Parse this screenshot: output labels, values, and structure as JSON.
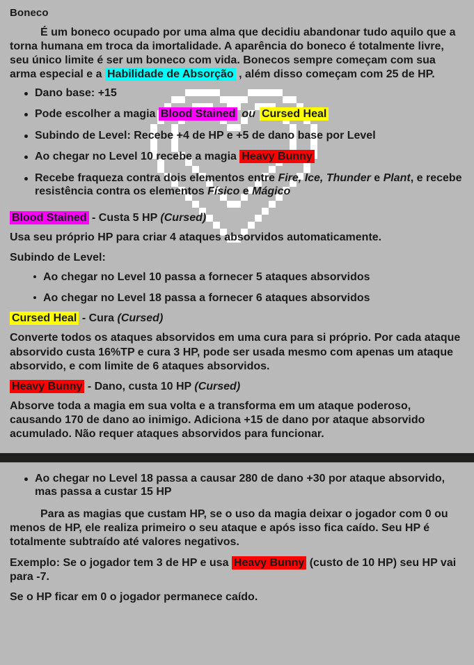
{
  "document": {
    "title": "Boneco",
    "background_color": "#b9b9b9",
    "band_color": "#1f1f1d",
    "watermark": "pixel-heart-outline"
  },
  "colors": {
    "cyan": "#00ffff",
    "magenta": "#ff00ff",
    "yellow": "#ffff00",
    "red": "#ff0000",
    "text": "#1a1a1a"
  },
  "intro": {
    "part1": "É um boneco ocupado por uma alma que decidiu abandonar tudo aquilo que a torna humana em troca da imortalidade. A aparência do boneco é totalmente livre, seu único limite é ser um boneco com vida. Bonecos sempre começam com sua arma especial e a ",
    "highlight": "Habilidade de Absorção",
    "part2": " , além disso começam com 25 de HP."
  },
  "class_bullets": {
    "b1": "Dano base: +15",
    "b2_pre": "Pode escolher a magia ",
    "b2_spell_a": "Blood Stained",
    "b2_conj": "ou",
    "b2_spell_b": "Cursed Heal",
    "b3": "Subindo de Level: Recebe +4 de HP e +5 de dano base por Level",
    "b4_pre": "Ao chegar no Level 10 recebe a magia ",
    "b4_spell": "Heavy Bunny",
    "b5_pre": "Recebe fraqueza contra dois elementos entre ",
    "b5_el1": "Fire, Ice, Thunder",
    "b5_mid": " e ",
    "b5_el2": "Plant",
    "b5_mid2": ", e recebe resistência contra os elementos ",
    "b5_el3": "Físico",
    "b5_mid3": " e ",
    "b5_el4": "Mágico"
  },
  "blood_stained": {
    "name": "Blood Stained",
    "cost": " - Custa 5 HP ",
    "tag": "(Cursed)",
    "desc": "Usa seu próprio HP para criar 4 ataques absorvidos automaticamente.",
    "level_label": "Subindo de Level:",
    "lvl10": "Ao chegar no Level 10 passa a fornecer 5 ataques absorvidos",
    "lvl18": "Ao chegar no Level 18 passa a fornecer 6 ataques absorvidos"
  },
  "cursed_heal": {
    "name": "Cursed Heal",
    "cost": " - Cura ",
    "tag": "(Cursed)",
    "desc": "Converte todos os ataques absorvidos em uma cura para si próprio. Por cada ataque absorvido custa 16%TP e cura 3 HP, pode ser usada mesmo com apenas um ataque absorvido, e com limite de 6 ataques absorvidos."
  },
  "heavy_bunny": {
    "name": "Heavy Bunny",
    "cost": " - Dano, custa 10 HP ",
    "tag": "(Cursed)",
    "desc": "Absorve toda a magia em sua volta e a transforma em um ataque poderoso, causando 170 de dano ao inimigo. Adiciona +15 de dano por ataque absorvido acumulado. Não requer ataques absorvidos para funcionar."
  },
  "bottom": {
    "bullet_lvl18": "Ao chegar no Level 18 passa a causar 280 de dano +30 por ataque absorvido, mas passa a custar 15 HP",
    "para_hp": "Para as magias que custam HP, se o uso da magia deixar o jogador com 0 ou menos de HP, ele realiza primeiro o seu ataque e após isso fica caído. Seu HP é totalmente subtraído até valores negativos.",
    "example_pre": "Exemplo: Se o jogador tem 3 de HP e usa ",
    "example_spell": "Heavy Bunny",
    "example_post": " (custo de 10 HP) seu HP vai para -7.",
    "final": "Se o HP ficar em 0 o jogador permanece caído."
  }
}
